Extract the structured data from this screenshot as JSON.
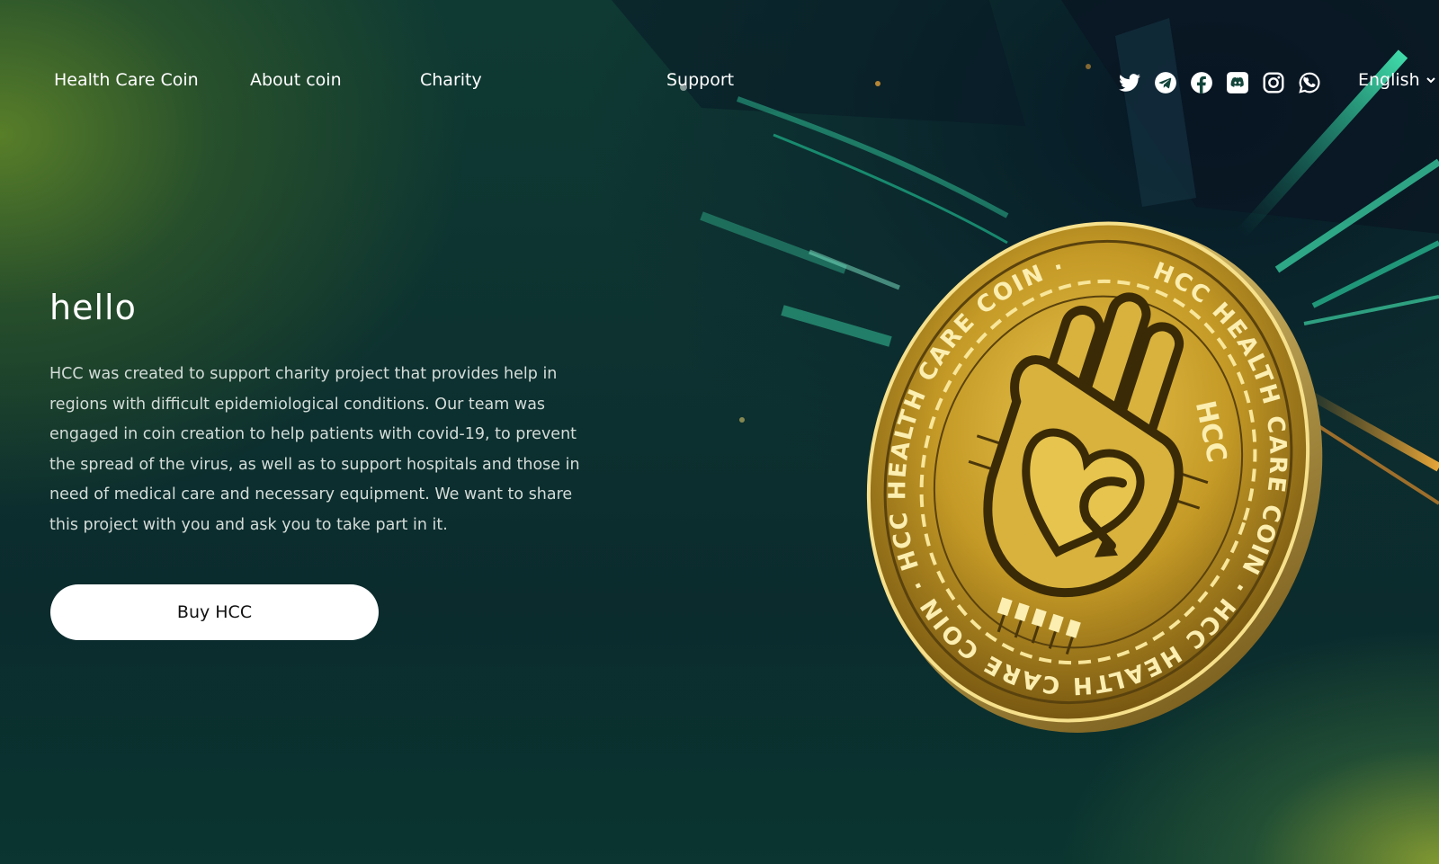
{
  "nav": {
    "brand": "Health Care Coin",
    "items": [
      {
        "label": "About coin"
      },
      {
        "label": "Charity"
      },
      {
        "label": "Support"
      }
    ]
  },
  "socials": [
    {
      "icon": "twitter-icon"
    },
    {
      "icon": "telegram-icon"
    },
    {
      "icon": "facebook-icon"
    },
    {
      "icon": "discord-icon"
    },
    {
      "icon": "instagram-icon"
    },
    {
      "icon": "whatsapp-icon"
    }
  ],
  "language": {
    "selected": "English",
    "icon": "chevron-down-icon"
  },
  "hero": {
    "title": "hello",
    "description": "HCC was created to support charity project that provides help in regions with difficult epidemiological conditions. Our team was engaged in coin creation to help patients with covid-19, to prevent the spread of the virus, as well as to support hospitals and those in need of medical care and necessary equipment. We want to share this project with you and ask you to take part in it.",
    "button_label": "Buy HCC"
  },
  "coin": {
    "ring_text": "HCC HEALTH CARE COIN · HCC HEALTH CARE COIN · HCC HEALTH CARE COIN ·",
    "badge": "HCC"
  },
  "colors": {
    "accent_green": "#2fd6a0",
    "coin_gold": "#c9a227",
    "button_bg": "#ffffff"
  }
}
